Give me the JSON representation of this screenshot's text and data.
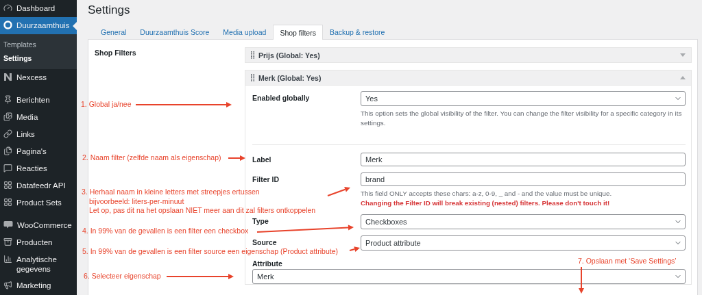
{
  "sidebar": {
    "groups": [
      [
        {
          "label": "Dashboard",
          "selected": false
        },
        {
          "label": "Duurzaamthuis",
          "selected": true,
          "children": [
            {
              "label": "Templates",
              "selected": false
            },
            {
              "label": "Settings",
              "selected": true
            }
          ]
        },
        {
          "label": "Nexcess",
          "selected": false
        }
      ],
      [
        {
          "label": "Berichten",
          "selected": false
        },
        {
          "label": "Media",
          "selected": false
        },
        {
          "label": "Links",
          "selected": false
        },
        {
          "label": "Pagina's",
          "selected": false
        },
        {
          "label": "Reacties",
          "selected": false
        },
        {
          "label": "Datafeedr API",
          "selected": false
        },
        {
          "label": "Product Sets",
          "selected": false
        }
      ],
      [
        {
          "label": "WooCommerce",
          "selected": false
        },
        {
          "label": "Producten",
          "selected": false
        },
        {
          "label": "Analytische gegevens",
          "selected": false
        },
        {
          "label": "Marketing",
          "selected": false
        }
      ]
    ]
  },
  "page_title": "Settings",
  "tabs": [
    {
      "label": "General",
      "selected": false
    },
    {
      "label": "Duurzaamthuis Score",
      "selected": false
    },
    {
      "label": "Media upload",
      "selected": false
    },
    {
      "label": "Shop filters",
      "selected": true
    },
    {
      "label": "Backup & restore",
      "selected": false
    }
  ],
  "section_label": "Shop Filters",
  "filters": [
    {
      "title": "Prijs (Global: Yes)",
      "expanded": false
    },
    {
      "title": "Merk (Global: Yes)",
      "expanded": true,
      "sections": [
        [
          {
            "kind": "select",
            "label": "Enabled globally",
            "value": "Yes",
            "description": "This option sets the global visibility of the filter. You can change the filter visibility for a specific category in its settings."
          }
        ],
        [
          {
            "kind": "text",
            "label": "Label",
            "value": "Merk"
          },
          {
            "kind": "text",
            "label": "Filter ID",
            "value": "brand",
            "description": "This field ONLY accepts these chars: a-z, 0-9, _ and - and the value must be unique.",
            "warning": "Changing the Filter ID will break existing (nested) filters. Please don't touch it!"
          },
          {
            "kind": "select",
            "label": "Type",
            "value": "Checkboxes"
          },
          {
            "kind": "select",
            "label": "Source",
            "value": "Product attribute"
          },
          {
            "kind": "select-stacked",
            "label": "Attribute",
            "value": "Merk"
          }
        ]
      ]
    }
  ],
  "annotations": [
    {
      "lines": [
        "1. Global ja/nee"
      ]
    },
    {
      "lines": [
        "2. Naam filter (zelfde naam als eigenschap)"
      ]
    },
    {
      "lines": [
        "3. Herhaal naam in kleine letters met streepjes ertussen",
        "bijvoorbeeld: liters-per-minuut",
        "Let op, pas dit na het opslaan NIET meer aan dit zal filters ontkoppelen"
      ]
    },
    {
      "lines": [
        "4. In 99% van de gevallen is een filter een checkbox"
      ]
    },
    {
      "lines": [
        "5. In 99% van de gevallen is een filter source een eigenschap (Product attribute)"
      ]
    },
    {
      "lines": [
        "6. Selecteer eigenschap"
      ]
    },
    {
      "lines": [
        "7. Opslaan met ‘Save Settings’"
      ]
    }
  ]
}
